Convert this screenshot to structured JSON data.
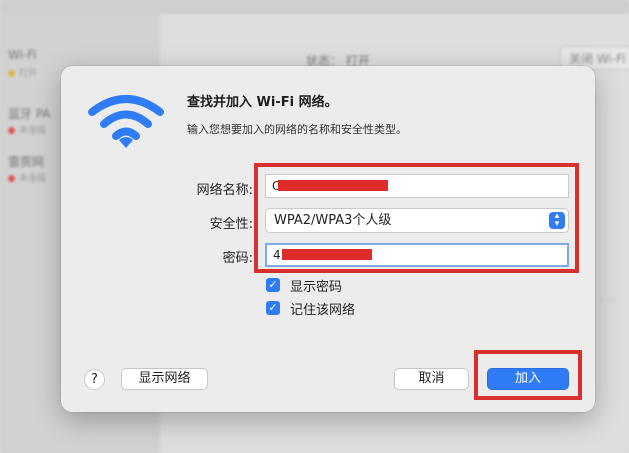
{
  "background": {
    "networks": [
      {
        "name": "Wi-Fi",
        "status": "打开"
      },
      {
        "name": "蓝牙 PA",
        "status": "未连接"
      },
      {
        "name": "雷雳网",
        "status": "未连接"
      }
    ],
    "status_label": "状态：",
    "status_value": "打开",
    "close_button": "关闭 Wi-Fi"
  },
  "dialog": {
    "title": "查找并加入 Wi-Fi 网络。",
    "subtitle": "输入您想要加入的网络的名称和安全性类型。",
    "network_name_label": "网络名称:",
    "network_name_value": "C",
    "security_label": "安全性:",
    "security_value": "WPA2/WPA3个人级",
    "password_label": "密码:",
    "password_value": "4",
    "show_password_label": "显示密码",
    "show_password_checked": true,
    "remember_network_label": "记住该网络",
    "remember_network_checked": true,
    "help_label": "?",
    "show_networks_button": "显示网络",
    "cancel_button": "取消",
    "join_button": "加入"
  },
  "colors": {
    "accent": "#2f7cf6",
    "highlight_red": "#d8302c",
    "redaction_red": "#e02b2b"
  },
  "icons": {
    "wifi": "wifi-icon",
    "dropdown": "chevron-updown-icon",
    "checkbox": "checkmark-icon"
  }
}
